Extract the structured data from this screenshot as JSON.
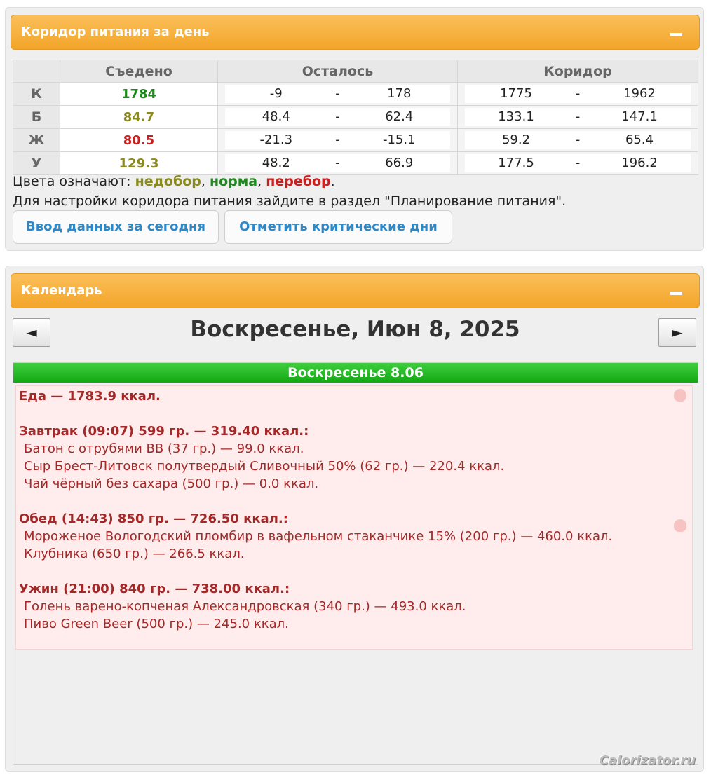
{
  "corridor": {
    "title": "Коридор питания за день",
    "headers": {
      "eaten": "Съедено",
      "left": "Осталось",
      "corridor": "Коридор"
    },
    "rows": [
      {
        "label": "К",
        "eaten": "1784",
        "left_from": "-9",
        "left_to": "178",
        "cor_from": "1775",
        "cor_to": "1962"
      },
      {
        "label": "Б",
        "eaten": "84.7",
        "left_from": "48.4",
        "left_to": "62.4",
        "cor_from": "133.1",
        "cor_to": "147.1"
      },
      {
        "label": "Ж",
        "eaten": "80.5",
        "left_from": "-21.3",
        "left_to": "-15.1",
        "cor_from": "59.2",
        "cor_to": "65.4"
      },
      {
        "label": "У",
        "eaten": "129.3",
        "left_from": "48.2",
        "left_to": "66.9",
        "cor_from": "177.5",
        "cor_to": "196.2"
      }
    ],
    "dash": "-",
    "eaten_colors": [
      "#1e8a1e",
      "#8a8a1e",
      "#cc1e1e",
      "#8a8a1e"
    ],
    "legend_prefix": "Цвета означают: ",
    "legend_under": "недобор",
    "legend_norm": "норма",
    "legend_over": "перебор",
    "legend_sep": ", ",
    "legend_end": ".",
    "hint": "Для настройки коридора питания зайдите в раздел \"Планирование питания\".",
    "btn_today": "Ввод данных за сегодня",
    "btn_critical": "Отметить критические дни"
  },
  "calendar": {
    "title": "Календарь",
    "prev": "◄",
    "next": "►",
    "date": "Воскресенье, Июн 8, 2025",
    "day_header": "Воскресенье 8.06",
    "food_total": "Еда — 1783.9 ккал.",
    "meals": [
      {
        "title": "Завтрак (09:07) 599 гр. — 319.40 ккал.:",
        "items": [
          "Батон с отрубями ВВ (37 гр.) — 99.0 ккал.",
          "Сыр Брест-Литовск полутвердый Сливочный 50% (62 гр.) — 220.4 ккал.",
          "Чай чёрный без сахара (500 гр.) — 0.0 ккал."
        ]
      },
      {
        "title": "Обед (14:43) 850 гр. — 726.50 ккал.:",
        "items": [
          "Мороженое Вологодский пломбир в вафельном стаканчике 15% (200 гр.) — 460.0 ккал.",
          "Клубника (650 гр.) — 266.5 ккал."
        ]
      },
      {
        "title": "Ужин (21:00) 840 гр. — 738.00 ккал.:",
        "items": [
          "Голень варено-копченая Александровская (340 гр.) — 493.0 ккал.",
          "Пиво Green Beer (500 гр.) — 245.0 ккал."
        ]
      }
    ]
  },
  "watermark": "Calorizator.ru"
}
